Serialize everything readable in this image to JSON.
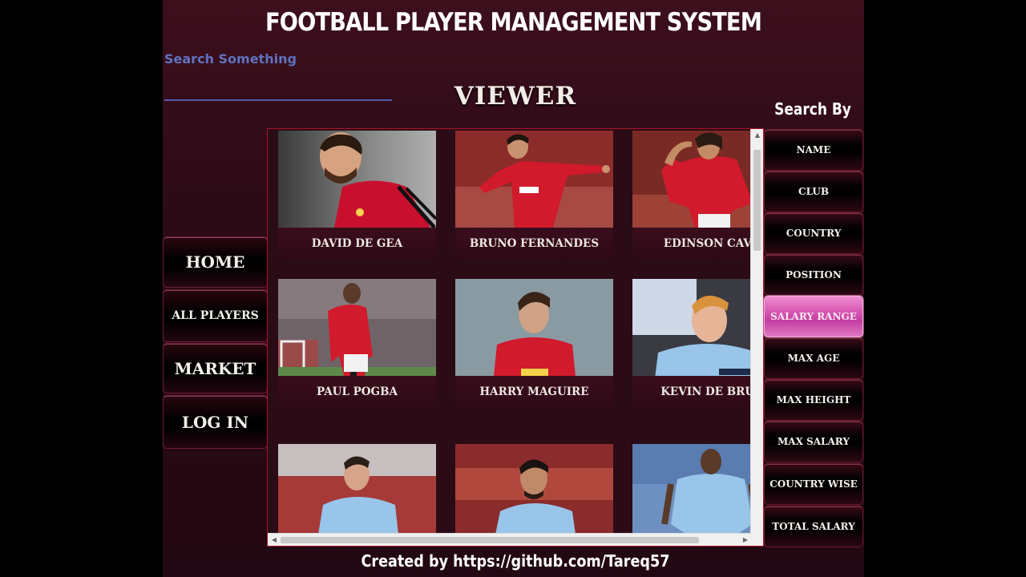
{
  "app": {
    "title": "FOOTBALL PLAYER MANAGEMENT SYSTEM",
    "footer": "Created by https://github.com/Tareq57"
  },
  "search": {
    "placeholder": "Search Something"
  },
  "viewer": {
    "title": "VIEWER"
  },
  "nav": {
    "home": "HOME",
    "all_players": "ALL PLAYERS",
    "market": "MARKET",
    "login": "LOG IN"
  },
  "search_by": {
    "title": "Search By",
    "options": [
      "NAME",
      "CLUB",
      "COUNTRY",
      "POSITION",
      "SALARY RANGE",
      "MAX AGE",
      "MAX HEIGHT",
      "MAX SALARY",
      "COUNTRY WISE",
      "TOTAL SALARY"
    ],
    "active": "SALARY RANGE"
  },
  "players": [
    {
      "name": "DAVID DE GEA",
      "kit": "red"
    },
    {
      "name": "BRUNO FERNANDES",
      "kit": "red"
    },
    {
      "name": "EDINSON CAVA",
      "kit": "red"
    },
    {
      "name": "PAUL POGBA",
      "kit": "red"
    },
    {
      "name": "HARRY MAGUIRE",
      "kit": "red"
    },
    {
      "name": "KEVIN DE BRUY",
      "kit": "sky-blue"
    },
    {
      "name": "",
      "kit": "sky-blue"
    },
    {
      "name": "",
      "kit": "sky-blue"
    },
    {
      "name": "",
      "kit": "sky-blue"
    }
  ],
  "colors": {
    "accent": "#d24fae",
    "background": "#3d0f1d",
    "gallery_border": "#a8142c",
    "search_underline": "#5060a8"
  }
}
